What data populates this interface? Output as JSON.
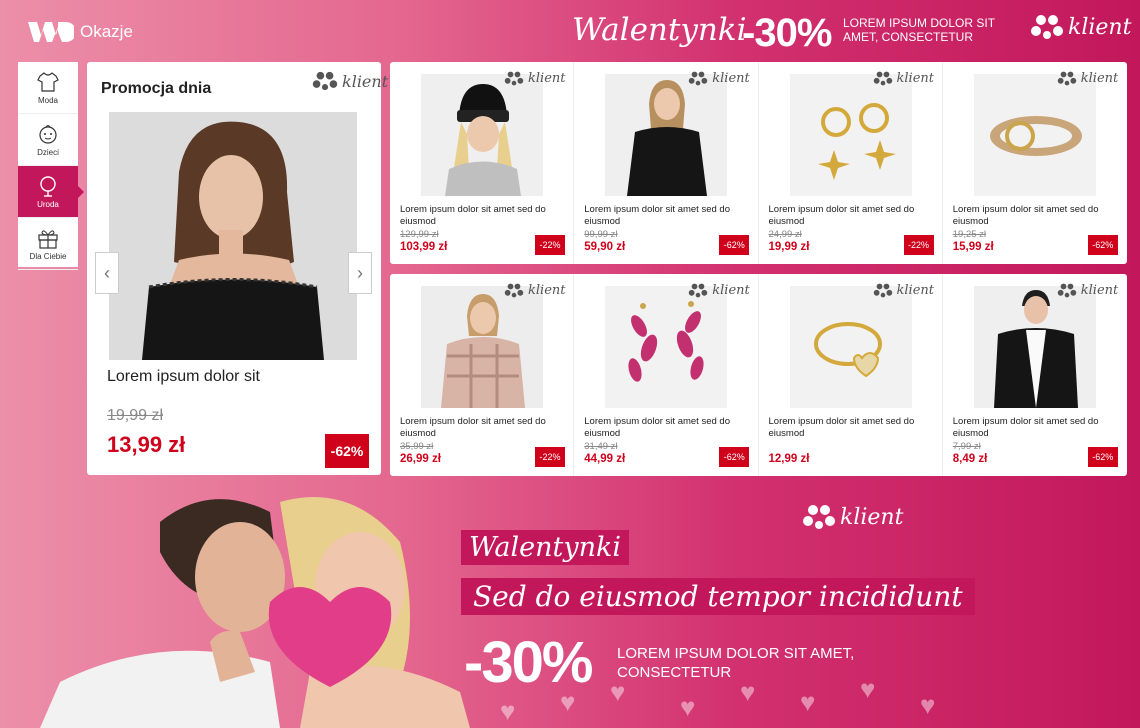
{
  "header": {
    "brand": "Okazje",
    "script_title": "Walentynki",
    "discount": "-30%",
    "tagline": "LOREM IPSUM DOLOR SIT AMET, CONSECTETUR",
    "klient_logo_text": "klient"
  },
  "sidebar": {
    "items": [
      {
        "label": "Moda",
        "icon": "shirt-icon"
      },
      {
        "label": "Dzieci",
        "icon": "child-icon"
      },
      {
        "label": "Uroda",
        "icon": "mirror-icon",
        "active": true
      },
      {
        "label": "Dla Ciebie",
        "icon": "gift-icon"
      }
    ]
  },
  "promo": {
    "title": "Promocja dnia",
    "klient_logo_text": "klient",
    "product_name": "Lorem ipsum dolor sit",
    "old_price": "19,99 zł",
    "new_price": "13,99 zł",
    "discount": "-62%"
  },
  "products": [
    {
      "name": "Lorem ipsum dolor sit amet sed do eiusmod",
      "old_price": "129,99 zł",
      "new_price": "103,99 zł",
      "discount": "-22%",
      "image": "beanie-woman"
    },
    {
      "name": "Lorem ipsum dolor sit amet sed do eiusmod",
      "old_price": "99,99 zł",
      "new_price": "59,90 zł",
      "discount": "-62%",
      "image": "black-top-woman"
    },
    {
      "name": "Lorem ipsum dolor sit amet sed do eiusmod",
      "old_price": "24,99 zł",
      "new_price": "19,99 zł",
      "discount": "-22%",
      "image": "star-earrings"
    },
    {
      "name": "Lorem ipsum dolor sit amet sed do eiusmod",
      "old_price": "19,25 zł",
      "new_price": "15,99 zł",
      "discount": "-62%",
      "image": "belt"
    },
    {
      "name": "Lorem ipsum dolor sit amet sed do eiusmod",
      "old_price": "35,99 zł",
      "new_price": "26,99 zł",
      "discount": "-22%",
      "image": "plaid-jacket-woman"
    },
    {
      "name": "Lorem ipsum dolor sit amet sed do eiusmod",
      "old_price": "31,49 zł",
      "new_price": "44,99 zł",
      "discount": "-62%",
      "image": "flower-earrings"
    },
    {
      "name": "Lorem ipsum dolor sit amet sed do eiusmod",
      "old_price": "",
      "new_price": "12,99 zł",
      "discount": "",
      "image": "heart-bracelet"
    },
    {
      "name": "Lorem ipsum dolor sit amet sed do eiusmod",
      "old_price": "7,99 zł",
      "new_price": "8,49 zł",
      "discount": "-62%",
      "image": "cardigan-man"
    }
  ],
  "banner": {
    "klient_logo_text": "klient",
    "script_title": "Walentynki",
    "script_subtitle": "Sed do eiusmod tempor incididunt",
    "discount": "-30%",
    "tagline": "LOREM IPSUM DOLOR SIT AMET, CONSECTETUR"
  },
  "colors": {
    "accent": "#c2185b",
    "price_red": "#d0021b",
    "pink_light": "#ec8fa9"
  }
}
